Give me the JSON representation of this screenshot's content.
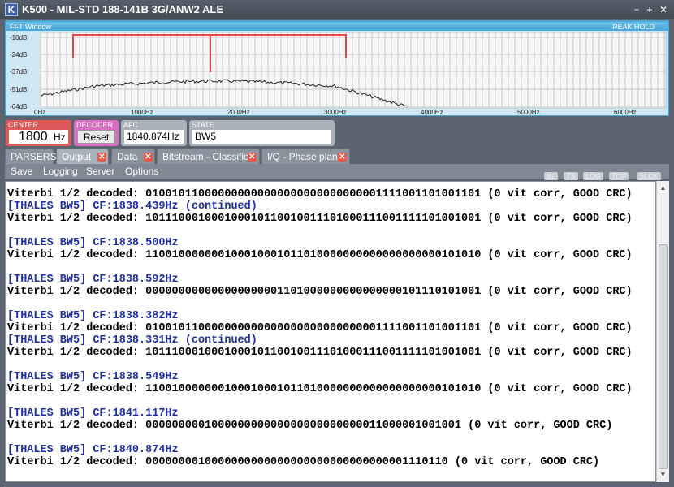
{
  "window": {
    "icon_letter": "K",
    "title": "K500 - MIL-STD 188-141B 3G/ANW2 ALE",
    "controls": [
      "−",
      "+",
      "✕"
    ]
  },
  "fft": {
    "title": "FFT Window",
    "mode": "PEAK HOLD",
    "y_labels": [
      "-10dB",
      "-24dB",
      "-37dB",
      "-51dB",
      "-64dB"
    ],
    "x_labels": [
      "0Hz",
      "1000Hz",
      "2000Hz",
      "3000Hz",
      "4000Hz",
      "5000Hz",
      "6000Hz"
    ]
  },
  "status": {
    "center_label": "CENTER",
    "center_value": "1800",
    "center_unit": "Hz",
    "decoder_label": "DECODER",
    "decoder_button": "Reset",
    "afc_label": "AFC",
    "afc_value": "1840.874Hz",
    "state_label": "STATE",
    "state_value": "BW5"
  },
  "tabs": [
    {
      "label": "PARSERS",
      "closable": false
    },
    {
      "label": "Output",
      "closable": true
    },
    {
      "label": "Data",
      "closable": true
    },
    {
      "label": "Bitstream - Classifier",
      "closable": true
    },
    {
      "label": "I/Q - Phase plane",
      "closable": true
    }
  ],
  "menu": [
    "Save",
    "Logging",
    "Server",
    "Options"
  ],
  "flags": [
    "BL",
    "TS",
    "LOG",
    "TCP",
    "SLCK"
  ],
  "log_lines": [
    {
      "type": "dec",
      "text": "Viterbi 1/2 decoded: 010010110000000000000000000000000001111001101001101 (0 vit corr, GOOD CRC)"
    },
    {
      "type": "hdr",
      "text": "[THALES BW5] CF:1838.439Hz (continued)"
    },
    {
      "type": "dec",
      "text": "Viterbi 1/2 decoded: 101110001000100010110010011101000111001111101001001 (0 vit corr, GOOD CRC)"
    },
    {
      "type": "blank",
      "text": ""
    },
    {
      "type": "hdr",
      "text": "[THALES BW5] CF:1838.500Hz"
    },
    {
      "type": "dec",
      "text": "Viterbi 1/2 decoded: 110010000000100010001011010000000000000000000101010 (0 vit corr, GOOD CRC)"
    },
    {
      "type": "blank",
      "text": ""
    },
    {
      "type": "hdr",
      "text": "[THALES BW5] CF:1838.592Hz"
    },
    {
      "type": "dec",
      "text": "Viterbi 1/2 decoded: 000000000000000000001101000000000000000101110101001 (0 vit corr, GOOD CRC)"
    },
    {
      "type": "blank",
      "text": ""
    },
    {
      "type": "hdr",
      "text": "[THALES BW5] CF:1838.382Hz"
    },
    {
      "type": "dec",
      "text": "Viterbi 1/2 decoded: 010010110000000000000000000000000001111001101001101 (0 vit corr, GOOD CRC)"
    },
    {
      "type": "hdr",
      "text": "[THALES BW5] CF:1838.331Hz (continued)"
    },
    {
      "type": "dec",
      "text": "Viterbi 1/2 decoded: 101110001000100010110010011101000111001111101001001 (0 vit corr, GOOD CRC)"
    },
    {
      "type": "blank",
      "text": ""
    },
    {
      "type": "hdr",
      "text": "[THALES BW5] CF:1838.549Hz"
    },
    {
      "type": "dec",
      "text": "Viterbi 1/2 decoded: 110010000000100010001011010000000000000000000101010 (0 vit corr, GOOD CRC)"
    },
    {
      "type": "blank",
      "text": ""
    },
    {
      "type": "hdr",
      "text": "[THALES BW5] CF:1841.117Hz"
    },
    {
      "type": "dec",
      "text": "Viterbi 1/2 decoded: 000000000100000000000000000000000011000001001001 (0 vit corr, GOOD CRC)"
    },
    {
      "type": "blank",
      "text": ""
    },
    {
      "type": "hdr",
      "text": "[THALES BW5] CF:1840.874Hz"
    },
    {
      "type": "dec",
      "text": "Viterbi 1/2 decoded: 0000000010000000000000000000000000000001110110 (0 vit corr, GOOD CRC)"
    }
  ]
}
